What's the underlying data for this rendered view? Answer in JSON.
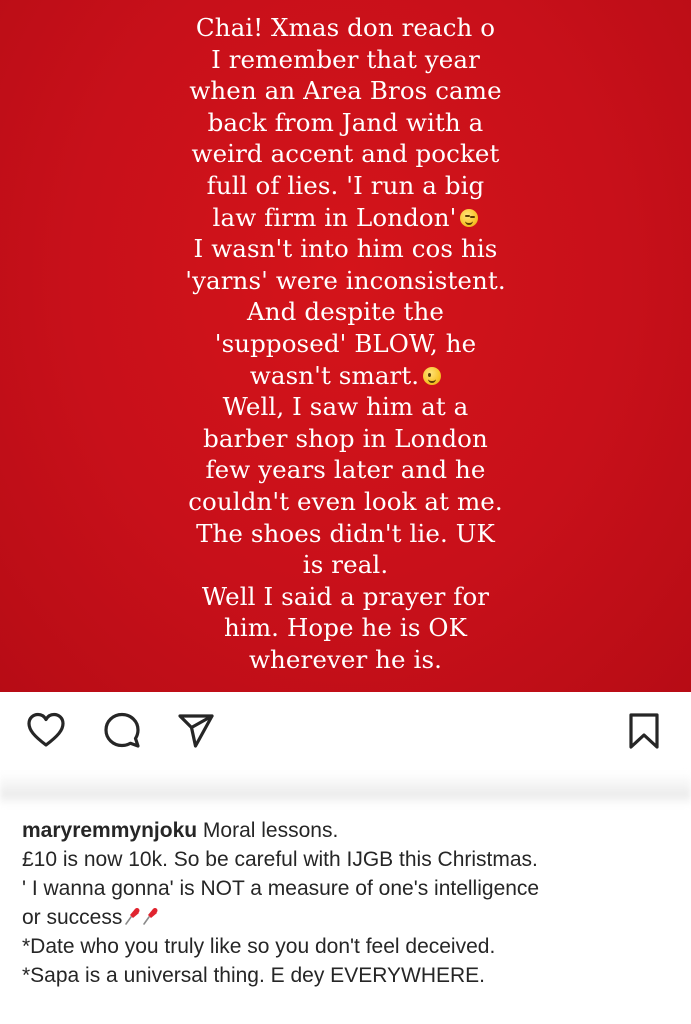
{
  "post": {
    "image_text_lines": [
      "Chai! Xmas don reach o",
      "I remember that year",
      "when an Area Bros came",
      "back from Jand with a",
      "weird accent and pocket",
      "full of lies. 'I run a big",
      "law firm in London'",
      "I wasn't into him cos his",
      "'yarns' were inconsistent.",
      "And despite the",
      "'supposed' BLOW, he",
      "wasn't smart.",
      "Well, I saw him at a",
      "barber shop in London",
      "few years later and he",
      "couldn't even look at me.",
      "The shoes didn't lie. UK",
      "is real.",
      "Well I said a prayer for",
      "him. Hope he is OK",
      "wherever he is."
    ],
    "emojis": {
      "after_law_firm_line": "winking-face-emoji",
      "after_wasnt_smart_line": "smiling-face-emoji"
    },
    "colors": {
      "background_red": "#c8101a",
      "text_white": "#ffffff"
    }
  },
  "actions": {
    "like_icon": "heart-icon",
    "comment_icon": "comment-icon",
    "share_icon": "send-icon",
    "save_icon": "bookmark-icon"
  },
  "caption": {
    "username": "maryremmynjoku",
    "first_line_text": "Moral lessons.",
    "lines": [
      "£10 is now 10k. So be careful with IJGB this Christmas.",
      "' I wanna gonna' is NOT a measure of one's intelligence",
      "or success",
      "*Date who you truly like so you don't feel deceived.",
      "*Sapa is a universal thing. E dey EVERYWHERE."
    ],
    "success_line_icon": "pushpin-icon"
  }
}
